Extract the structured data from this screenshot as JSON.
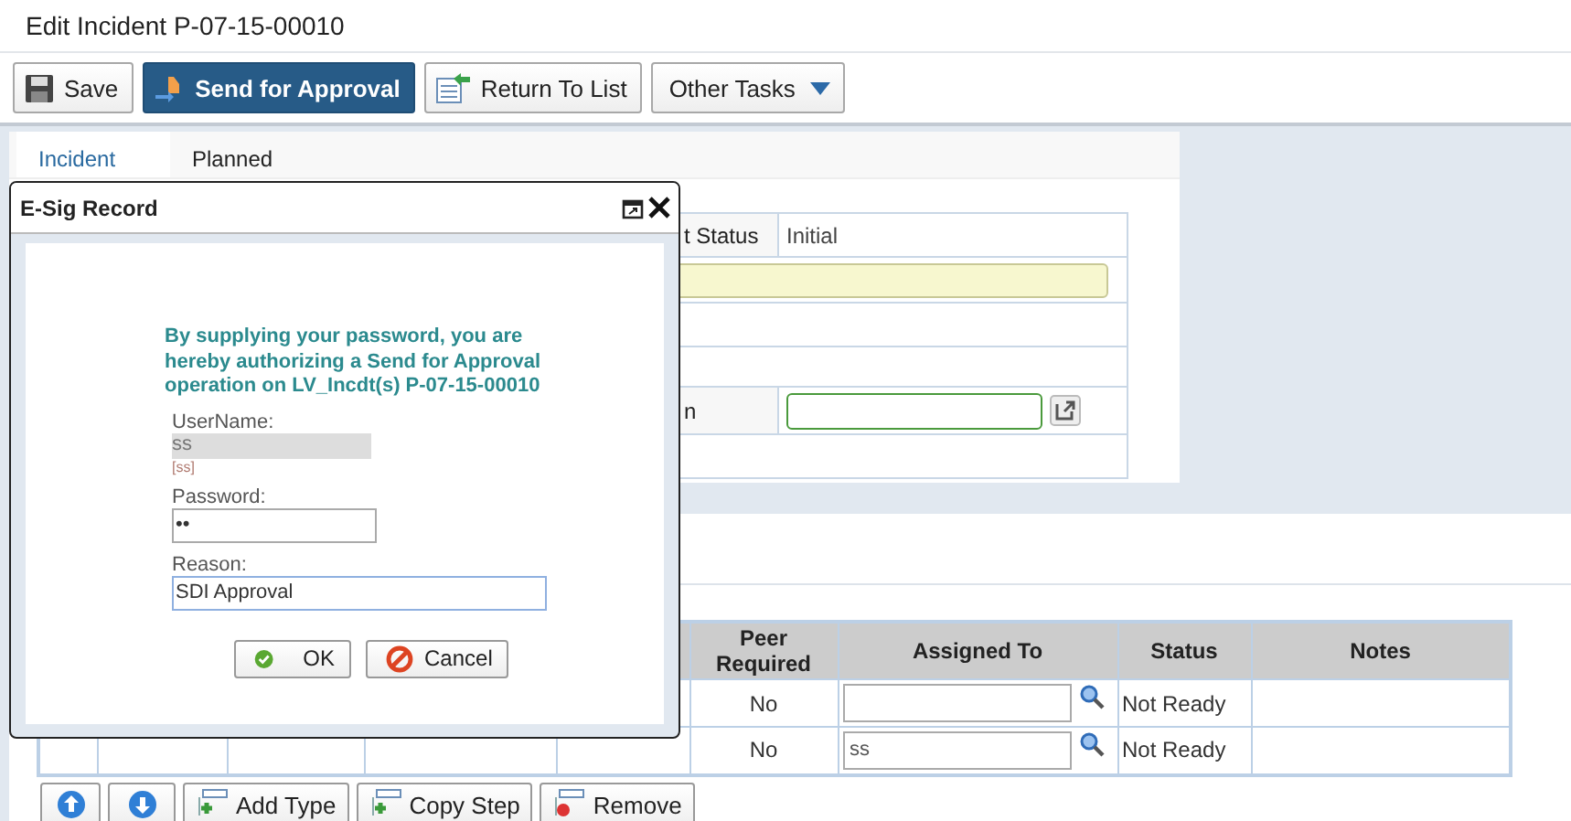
{
  "page": {
    "title": "Edit Incident P-07-15-00010"
  },
  "toolbar": [
    {
      "label": "Save",
      "kind": "save",
      "primary": false
    },
    {
      "label": "Send for Approval",
      "kind": "send",
      "primary": true
    },
    {
      "label": "Return To List",
      "kind": "return",
      "primary": false
    },
    {
      "label": "Other Tasks",
      "kind": "menu",
      "primary": false
    }
  ],
  "tabs": [
    {
      "label": "Incident",
      "selected": true
    },
    {
      "label": "Planned",
      "selected": false
    }
  ],
  "form": {
    "rows": [
      {
        "kind": "text",
        "label": "t Status",
        "value": "Initial"
      },
      {
        "kind": "highlight_field"
      },
      {
        "kind": "empty"
      },
      {
        "kind": "empty"
      },
      {
        "kind": "lookup_field",
        "label": "n"
      },
      {
        "kind": "empty"
      }
    ]
  },
  "steps_table": {
    "columns": [
      "Peer Required",
      "Assigned To",
      "Status",
      "Notes"
    ],
    "rows": [
      {
        "peer_required": "No",
        "assigned_to": "",
        "status": "Not Ready"
      },
      {
        "peer_required": "No",
        "assigned_to": "ss",
        "status": "Not Ready"
      }
    ]
  },
  "step_buttons": [
    {
      "kind": "move_up"
    },
    {
      "kind": "move_down"
    },
    {
      "kind": "add",
      "label": "Add Type"
    },
    {
      "kind": "copy",
      "label": "Copy Step"
    },
    {
      "kind": "remove",
      "label": "Remove"
    }
  ],
  "dialog": {
    "title": "E-Sig Record",
    "message": "By supplying your password, you are hereby authorizing a Send for Approval operation on LV_Incdt(s) P-07-15-00010",
    "username_label": "UserName:",
    "username": "ss",
    "username_hint": "[ss]",
    "password_label": "Password:",
    "password": "••",
    "reason_label": "Reason:",
    "reason": "SDI Approval",
    "buttons": [
      {
        "kind": "ok",
        "label": "OK"
      },
      {
        "kind": "cancel",
        "label": "Cancel"
      }
    ]
  }
}
